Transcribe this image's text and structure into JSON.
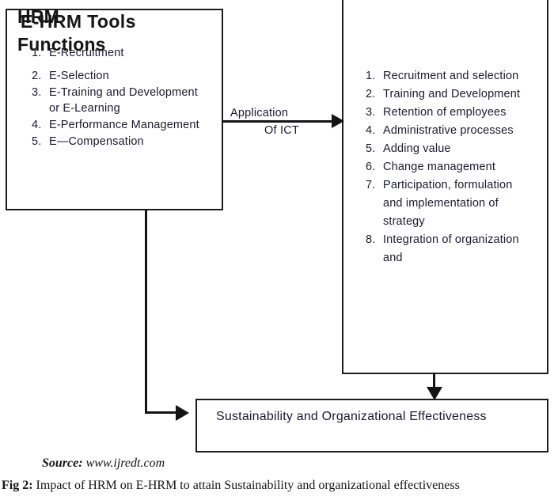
{
  "figure": {
    "boxes": {
      "tools": {
        "title": "E-HRM Tools",
        "items": [
          {
            "num": "1.",
            "text": "E-Recruitment"
          },
          {
            "num": "2.",
            "text": "E-Selection"
          },
          {
            "num": "3.",
            "text": "E-Training and Development or E-Learning"
          },
          {
            "num": "4.",
            "text": "E-Performance Management"
          },
          {
            "num": "5.",
            "text": "E—Compensation"
          }
        ]
      },
      "functions": {
        "title_line1": "HRM",
        "title_line2": "Functions",
        "items": [
          {
            "num": "1.",
            "text": "Recruitment and selection"
          },
          {
            "num": "2.",
            "text": "Training and Development"
          },
          {
            "num": "3.",
            "text": "Retention of employees"
          },
          {
            "num": "4.",
            "text": "Administrative processes"
          },
          {
            "num": "5.",
            "text": "Adding value"
          },
          {
            "num": "6.",
            "text": "Change management"
          },
          {
            "num": "7.",
            "text": "Participation, formulation and implementation of strategy"
          },
          {
            "num": "8.",
            "text": "Integration of organization and"
          }
        ]
      },
      "outcome": {
        "text": "Sustainability and Organizational Effectiveness"
      }
    },
    "connectors": {
      "ict_label_line1": "Application",
      "ict_label_line2": "Of ICT"
    },
    "footer": {
      "source_label": "Source:",
      "source_url": "www.ijredt.com",
      "caption_label": "Fig 2:",
      "caption_text": "Impact of HRM on E-HRM to attain Sustainability and organizational effectiveness"
    },
    "colors": {
      "stroke": "#1c1c1c",
      "text": "#1b1b2e",
      "background": "#ffffff"
    }
  }
}
